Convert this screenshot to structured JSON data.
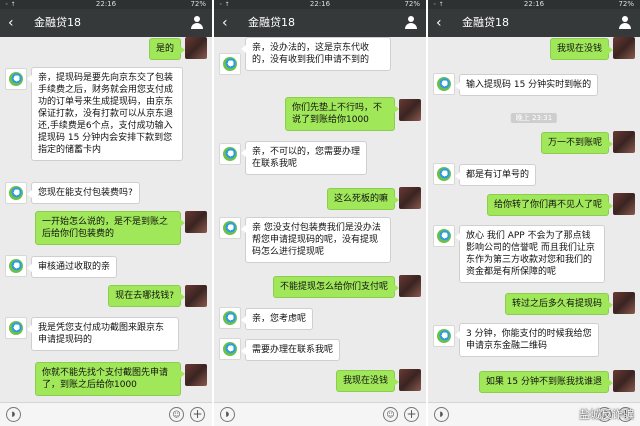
{
  "status": {
    "left": "◦ ↑",
    "time": "22:16",
    "right": "72%"
  },
  "contact": {
    "name": "金融贷18",
    "back": "‹"
  },
  "icons": {
    "voice": "voice-icon",
    "emoji": "emoji-icon",
    "plus": "plus-icon",
    "profile": "person-icon"
  },
  "colors": {
    "outgoing_bubble": "#a0e75a",
    "nav_bar": "#36393a"
  },
  "panels": [
    {
      "messages": [
        {
          "side": "out",
          "text": "是的"
        },
        {
          "side": "in",
          "text": "亲，提现码是要先向京东交了包装手续费之后，财务就会用您支付成功的订单号来生成提现码，由京东保证打款，没有打款可以从京东退还,手续费是6个点，支付成功输入提现码 15 分钟内会安排下款到您指定的储蓄卡内"
        },
        {
          "side": "in",
          "text": "您现在能支付包装费吗?"
        },
        {
          "side": "out",
          "text": "一开始怎么说的，是不是到账之后给你们包装费的"
        },
        {
          "side": "in",
          "text": "审核通过收取的亲"
        },
        {
          "side": "out",
          "text": "现在去哪找钱?"
        },
        {
          "side": "in",
          "text": "我是凭您支付成功截图来跟京东申请提现码的"
        },
        {
          "side": "out",
          "text": "你就不能先找个支付截图先申请了，到账之后给你1000"
        }
      ]
    },
    {
      "messages": [
        {
          "side": "in",
          "text": "亲，没办法的，这是京东代收的，没有收到我们申请不到的"
        },
        {
          "side": "out",
          "text": "你们先垫上不行吗，不说了到账给你1000"
        },
        {
          "side": "in",
          "text": "亲，不可以的，您需要办理在联系我呢"
        },
        {
          "side": "out",
          "text": "这么死板的嘛"
        },
        {
          "side": "in",
          "text": "亲 您没支付包装费我们是没办法帮您申请提现码的呢，没有提现码怎么进行提现呢"
        },
        {
          "side": "out",
          "text": "不能提现怎么给你们支付呢"
        },
        {
          "side": "in",
          "text": "亲，您考虑呢"
        },
        {
          "side": "in",
          "text": "需要办理在联系我呢"
        },
        {
          "side": "out",
          "text": "我现在没钱"
        }
      ]
    },
    {
      "messages": [
        {
          "side": "out",
          "text": "我现在没钱"
        },
        {
          "side": "in",
          "text": "输入提现码 15 分钟实时到帐的"
        },
        {
          "side": "time",
          "text": "晚上 23:31"
        },
        {
          "side": "out",
          "text": "万一不到账呢"
        },
        {
          "side": "in",
          "text": "都是有订单号的"
        },
        {
          "side": "out",
          "text": "给你转了你们再不见人了呢"
        },
        {
          "side": "in",
          "text": "放心 我们 APP 不会为了那点钱影响公司的信誉呢 而且我们让京东作为第三方收款对您和我们的资金都是有所保障的呢"
        },
        {
          "side": "out",
          "text": "转过之后多久有提现码"
        },
        {
          "side": "in",
          "text": "3 分钟，你能支付的时候我给您申请京东金融二维码"
        },
        {
          "side": "out",
          "text": "如果 15 分钟不到账我找谁退"
        }
      ]
    }
  ],
  "watermark": "盐城反诈骗"
}
